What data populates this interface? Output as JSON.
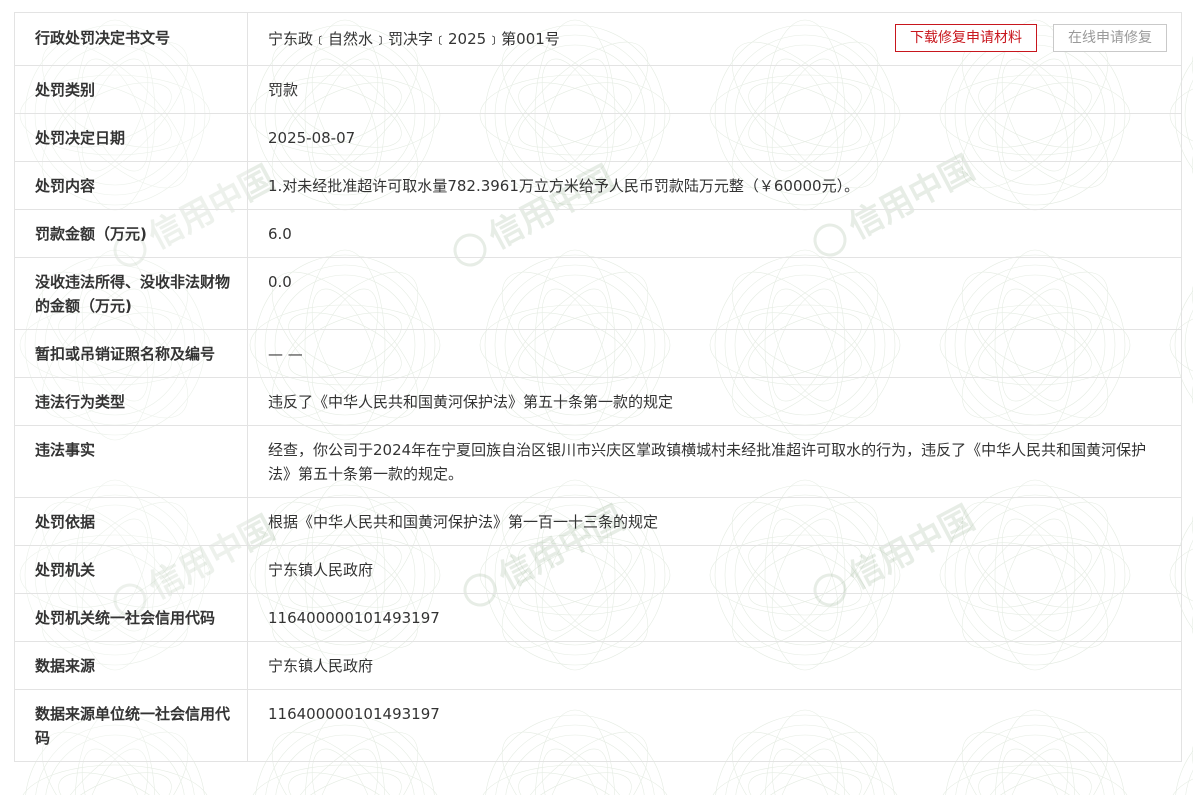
{
  "rows": [
    {
      "label": "行政处罚决定书文号",
      "value": "宁东政﹝自然水﹞罚决字﹝2025﹞第001号"
    },
    {
      "label": "处罚类别",
      "value": "罚款"
    },
    {
      "label": "处罚决定日期",
      "value": "2025-08-07"
    },
    {
      "label": "处罚内容",
      "value": "1.对未经批准超许可取水量782.3961万立方米给予人民币罚款陆万元整（￥60000元）。"
    },
    {
      "label": "罚款金额（万元)",
      "value": "6.0"
    },
    {
      "label": "没收违法所得、没收非法财物的金额（万元)",
      "value": "0.0"
    },
    {
      "label": "暂扣或吊销证照名称及编号",
      "value": "— —"
    },
    {
      "label": "违法行为类型",
      "value": "违反了《中华人民共和国黄河保护法》第五十条第一款的规定"
    },
    {
      "label": "违法事实",
      "value": "经查，你公司于2024年在宁夏回族自治区银川市兴庆区掌政镇横城村未经批准超许可取水的行为，违反了《中华人民共和国黄河保护法》第五十条第一款的规定。"
    },
    {
      "label": "处罚依据",
      "value": "根据《中华人民共和国黄河保护法》第一百一十三条的规定"
    },
    {
      "label": "处罚机关",
      "value": "宁东镇人民政府"
    },
    {
      "label": "处罚机关统一社会信用代码",
      "value": "116400000101493197"
    },
    {
      "label": "数据来源",
      "value": "宁东镇人民政府"
    },
    {
      "label": "数据来源单位统一社会信用代码",
      "value": "116400000101493197"
    }
  ],
  "buttons": {
    "download": "下载修复申请材料",
    "online": "在线申请修复"
  },
  "watermark": {
    "text": "信用中国",
    "icon": "emblem-icon",
    "color": "#6e8f6a"
  },
  "colors": {
    "accent": "#c8161d",
    "border": "#e3e3e3",
    "disabled": "#9a9a9a"
  }
}
